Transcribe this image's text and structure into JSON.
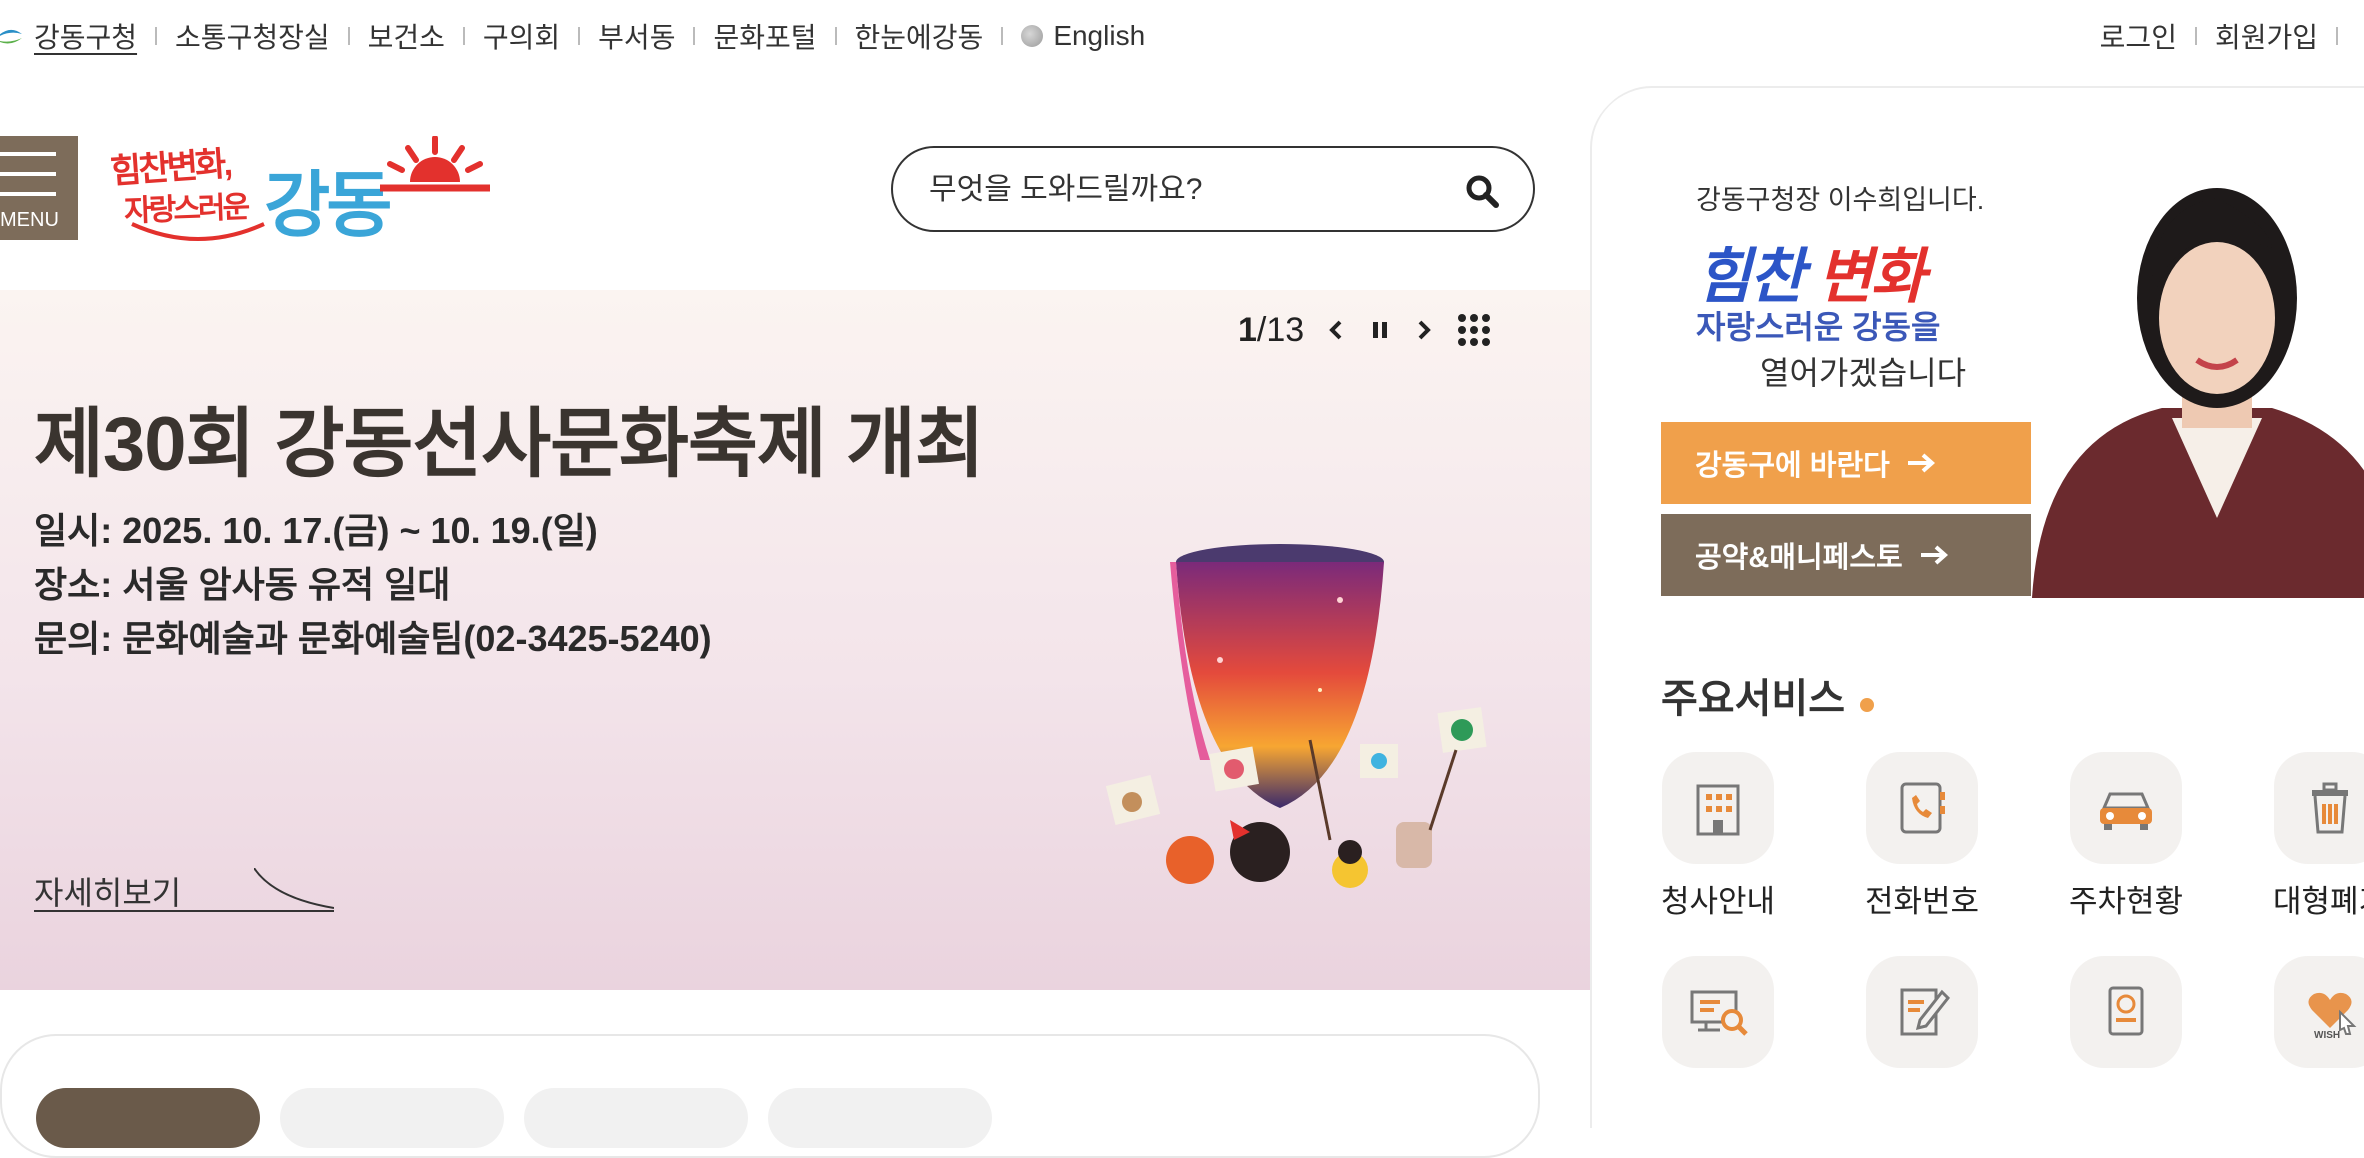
{
  "topnav": {
    "items": [
      "강동구청",
      "소통구청장실",
      "보건소",
      "구의회",
      "부서동",
      "문화포털",
      "한눈에강동",
      "English"
    ],
    "right_items": [
      "로그인",
      "회원가입"
    ]
  },
  "header": {
    "menu_label": "MENU",
    "logo_slogan_line1": "힘찬변화,",
    "logo_slogan_line2": "자랑스러운",
    "logo_name": "강동",
    "search_placeholder": "무엇을 도와드릴까요?"
  },
  "hero": {
    "pager_current": "1",
    "pager_total": "/13",
    "title": "제30회 강동선사문화축제 개최",
    "lines": [
      "일시: 2025. 10. 17.(금) ~ 10. 19.(일)",
      "장소: 서울 암사동 유적 일대",
      "문의: 문화예술과 문화예술팀(02-3425-5240)"
    ],
    "more_label": "자세히보기"
  },
  "mayor": {
    "greeting": "강동구청장 이수희입니다.",
    "slogan_a": "힘찬",
    "slogan_b": "변화",
    "slogan_line2": "자랑스러운 강동을",
    "slogan_line3": "열어가겠습니다",
    "btn_wish": "강동구에 바란다",
    "btn_pledge": "공약&매니페스토"
  },
  "services": {
    "title": "주요서비스",
    "items": [
      {
        "label": "청사안내",
        "icon": "building-icon"
      },
      {
        "label": "전화번호",
        "icon": "phone-book-icon"
      },
      {
        "label": "주차현황",
        "icon": "car-icon"
      },
      {
        "label": "대형폐기",
        "icon": "trash-bin-icon"
      },
      {
        "label": "",
        "icon": "monitor-search-icon"
      },
      {
        "label": "",
        "icon": "document-edit-icon"
      },
      {
        "label": "",
        "icon": "passport-icon"
      },
      {
        "label": "",
        "icon": "wish-heart-icon"
      }
    ]
  },
  "colors": {
    "brand_brown": "#7d6c5a",
    "accent_orange": "#f0a04b",
    "hero_pink": "#ead3de",
    "logo_blue": "#3aa5d8",
    "logo_red": "#e3312d"
  }
}
